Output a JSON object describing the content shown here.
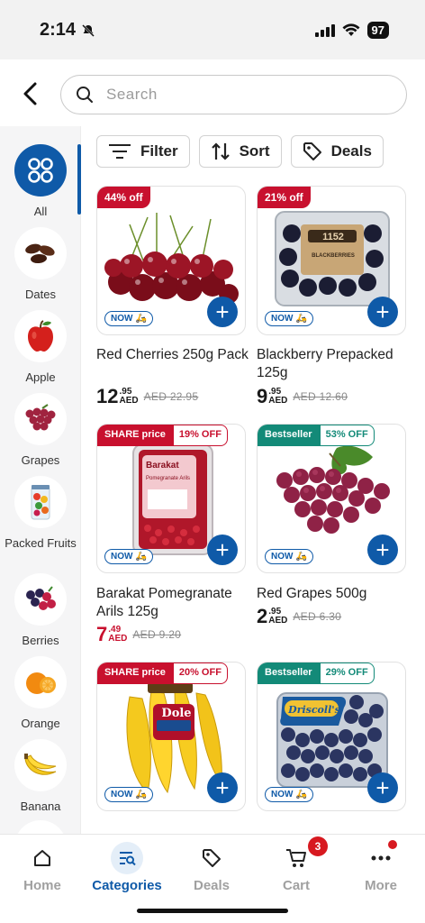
{
  "status": {
    "time": "2:14",
    "battery": "97"
  },
  "search": {
    "placeholder": "Search"
  },
  "categories": [
    {
      "label": "All",
      "icon": "all-grid-icon"
    },
    {
      "label": "Dates",
      "icon": "dates-image"
    },
    {
      "label": "Apple",
      "icon": "apple-image"
    },
    {
      "label": "Grapes",
      "icon": "grapes-image"
    },
    {
      "label": "Packed Fruits",
      "icon": "packed-fruits-image"
    },
    {
      "label": "Berries",
      "icon": "berries-image"
    },
    {
      "label": "Orange",
      "icon": "orange-image"
    },
    {
      "label": "Banana",
      "icon": "banana-image"
    }
  ],
  "toolbar": {
    "filter": "Filter",
    "sort": "Sort",
    "deals": "Deals"
  },
  "products": [
    {
      "badge": "44% off",
      "name": "Red Cherries 250g Pack",
      "price_int": "12",
      "price_dec": ".95",
      "currency": "AED",
      "old_price": "AED 22.95",
      "delivery": "NOW"
    },
    {
      "badge": "21% off",
      "name": "Blackberry Prepacked 125g",
      "price_int": "9",
      "price_dec": ".95",
      "currency": "AED",
      "old_price": "AED 12.60",
      "delivery": "NOW"
    },
    {
      "badge": "SHARE price",
      "badge_pct": "19% OFF",
      "name": "Barakat Pomegranate Arils 125g",
      "price_int": "7",
      "price_dec": ".49",
      "currency": "AED",
      "old_price": "AED 9.20",
      "delivery": "NOW"
    },
    {
      "badge": "Bestseller",
      "badge_pct": "53% OFF",
      "name": "Red Grapes 500g",
      "price_int": "2",
      "price_dec": ".95",
      "currency": "AED",
      "old_price": "AED 6.30",
      "delivery": "NOW"
    },
    {
      "badge": "SHARE price",
      "badge_pct": "20% OFF",
      "delivery": "NOW",
      "package_text": "Dole"
    },
    {
      "badge": "Bestseller",
      "badge_pct": "29% OFF",
      "delivery": "NOW",
      "package_text": "Driscoll's"
    }
  ],
  "product_labels": {
    "blackberry_pack": "1152",
    "blackberry_pack_sub": "BLACKBERRIES",
    "pomegranate_brand": "Barakat",
    "pomegranate_sub": "Pomegranate Arils"
  },
  "tabs": [
    {
      "label": "Home",
      "icon": "home-icon"
    },
    {
      "label": "Categories",
      "icon": "categories-icon"
    },
    {
      "label": "Deals",
      "icon": "tag-icon"
    },
    {
      "label": "Cart",
      "icon": "cart-icon",
      "badge": "3"
    },
    {
      "label": "More",
      "icon": "more-icon"
    }
  ],
  "colors": {
    "brand": "#0f5aa8",
    "sale": "#c8102e",
    "bestseller": "#138a78"
  }
}
